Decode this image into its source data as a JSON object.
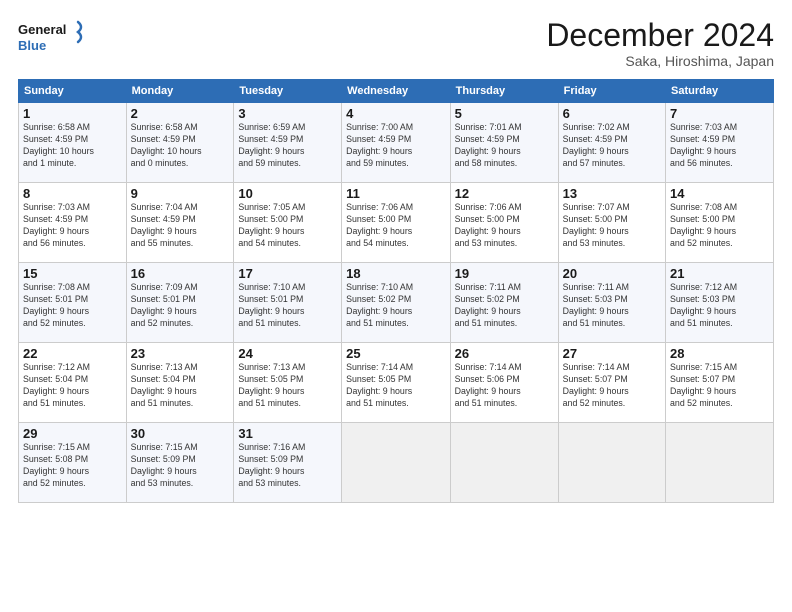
{
  "logo": {
    "line1": "General",
    "line2": "Blue"
  },
  "title": "December 2024",
  "subtitle": "Saka, Hiroshima, Japan",
  "days_of_week": [
    "Sunday",
    "Monday",
    "Tuesday",
    "Wednesday",
    "Thursday",
    "Friday",
    "Saturday"
  ],
  "weeks": [
    [
      {
        "day": "1",
        "info": "Sunrise: 6:58 AM\nSunset: 4:59 PM\nDaylight: 10 hours\nand 1 minute."
      },
      {
        "day": "2",
        "info": "Sunrise: 6:58 AM\nSunset: 4:59 PM\nDaylight: 10 hours\nand 0 minutes."
      },
      {
        "day": "3",
        "info": "Sunrise: 6:59 AM\nSunset: 4:59 PM\nDaylight: 9 hours\nand 59 minutes."
      },
      {
        "day": "4",
        "info": "Sunrise: 7:00 AM\nSunset: 4:59 PM\nDaylight: 9 hours\nand 59 minutes."
      },
      {
        "day": "5",
        "info": "Sunrise: 7:01 AM\nSunset: 4:59 PM\nDaylight: 9 hours\nand 58 minutes."
      },
      {
        "day": "6",
        "info": "Sunrise: 7:02 AM\nSunset: 4:59 PM\nDaylight: 9 hours\nand 57 minutes."
      },
      {
        "day": "7",
        "info": "Sunrise: 7:03 AM\nSunset: 4:59 PM\nDaylight: 9 hours\nand 56 minutes."
      }
    ],
    [
      {
        "day": "8",
        "info": "Sunrise: 7:03 AM\nSunset: 4:59 PM\nDaylight: 9 hours\nand 56 minutes."
      },
      {
        "day": "9",
        "info": "Sunrise: 7:04 AM\nSunset: 4:59 PM\nDaylight: 9 hours\nand 55 minutes."
      },
      {
        "day": "10",
        "info": "Sunrise: 7:05 AM\nSunset: 5:00 PM\nDaylight: 9 hours\nand 54 minutes."
      },
      {
        "day": "11",
        "info": "Sunrise: 7:06 AM\nSunset: 5:00 PM\nDaylight: 9 hours\nand 54 minutes."
      },
      {
        "day": "12",
        "info": "Sunrise: 7:06 AM\nSunset: 5:00 PM\nDaylight: 9 hours\nand 53 minutes."
      },
      {
        "day": "13",
        "info": "Sunrise: 7:07 AM\nSunset: 5:00 PM\nDaylight: 9 hours\nand 53 minutes."
      },
      {
        "day": "14",
        "info": "Sunrise: 7:08 AM\nSunset: 5:00 PM\nDaylight: 9 hours\nand 52 minutes."
      }
    ],
    [
      {
        "day": "15",
        "info": "Sunrise: 7:08 AM\nSunset: 5:01 PM\nDaylight: 9 hours\nand 52 minutes."
      },
      {
        "day": "16",
        "info": "Sunrise: 7:09 AM\nSunset: 5:01 PM\nDaylight: 9 hours\nand 52 minutes."
      },
      {
        "day": "17",
        "info": "Sunrise: 7:10 AM\nSunset: 5:01 PM\nDaylight: 9 hours\nand 51 minutes."
      },
      {
        "day": "18",
        "info": "Sunrise: 7:10 AM\nSunset: 5:02 PM\nDaylight: 9 hours\nand 51 minutes."
      },
      {
        "day": "19",
        "info": "Sunrise: 7:11 AM\nSunset: 5:02 PM\nDaylight: 9 hours\nand 51 minutes."
      },
      {
        "day": "20",
        "info": "Sunrise: 7:11 AM\nSunset: 5:03 PM\nDaylight: 9 hours\nand 51 minutes."
      },
      {
        "day": "21",
        "info": "Sunrise: 7:12 AM\nSunset: 5:03 PM\nDaylight: 9 hours\nand 51 minutes."
      }
    ],
    [
      {
        "day": "22",
        "info": "Sunrise: 7:12 AM\nSunset: 5:04 PM\nDaylight: 9 hours\nand 51 minutes."
      },
      {
        "day": "23",
        "info": "Sunrise: 7:13 AM\nSunset: 5:04 PM\nDaylight: 9 hours\nand 51 minutes."
      },
      {
        "day": "24",
        "info": "Sunrise: 7:13 AM\nSunset: 5:05 PM\nDaylight: 9 hours\nand 51 minutes."
      },
      {
        "day": "25",
        "info": "Sunrise: 7:14 AM\nSunset: 5:05 PM\nDaylight: 9 hours\nand 51 minutes."
      },
      {
        "day": "26",
        "info": "Sunrise: 7:14 AM\nSunset: 5:06 PM\nDaylight: 9 hours\nand 51 minutes."
      },
      {
        "day": "27",
        "info": "Sunrise: 7:14 AM\nSunset: 5:07 PM\nDaylight: 9 hours\nand 52 minutes."
      },
      {
        "day": "28",
        "info": "Sunrise: 7:15 AM\nSunset: 5:07 PM\nDaylight: 9 hours\nand 52 minutes."
      }
    ],
    [
      {
        "day": "29",
        "info": "Sunrise: 7:15 AM\nSunset: 5:08 PM\nDaylight: 9 hours\nand 52 minutes."
      },
      {
        "day": "30",
        "info": "Sunrise: 7:15 AM\nSunset: 5:09 PM\nDaylight: 9 hours\nand 53 minutes."
      },
      {
        "day": "31",
        "info": "Sunrise: 7:16 AM\nSunset: 5:09 PM\nDaylight: 9 hours\nand 53 minutes."
      },
      null,
      null,
      null,
      null
    ]
  ]
}
